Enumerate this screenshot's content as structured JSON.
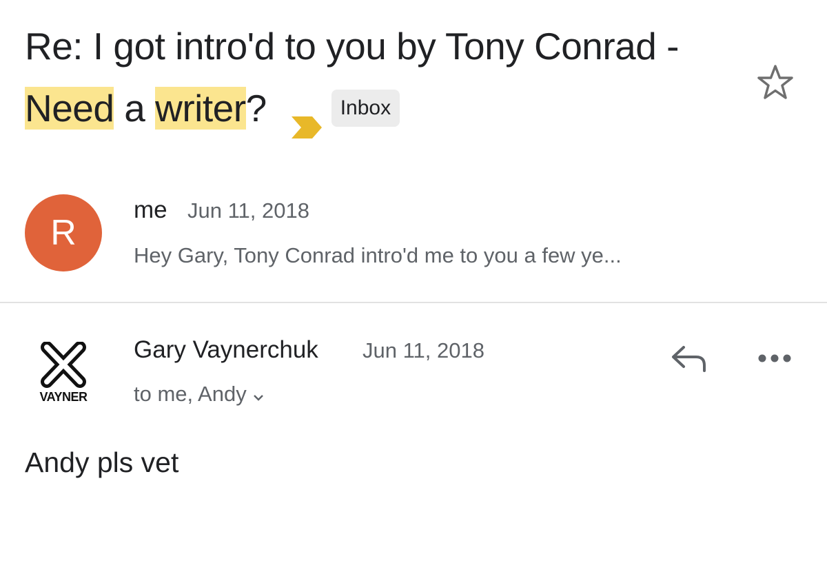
{
  "email": {
    "subject": {
      "part1": "Re: I got intro'd to you by Tony Conrad - ",
      "highlight1": "Need",
      "part2": " a ",
      "highlight2": "writer",
      "part3": "?"
    },
    "importance_marker_icon": "importance-chevron-icon",
    "label": "Inbox",
    "star_icon": "star-outline-icon",
    "colors": {
      "highlight": "#fbe58f",
      "importance": "#e8b829",
      "avatar": "#e0633a"
    }
  },
  "messages": [
    {
      "avatar_letter": "R",
      "sender": "me",
      "date": "Jun 11, 2018",
      "snippet": "Hey Gary, Tony Conrad intro'd me to you a few ye..."
    },
    {
      "avatar_logo": "VAYNER",
      "sender": "Gary Vaynerchuk",
      "date": "Jun 11, 2018",
      "recipients": "to me, Andy",
      "reply_icon": "reply-icon",
      "more_icon": "more-horizontal-icon",
      "body": "Andy pls vet"
    }
  ]
}
